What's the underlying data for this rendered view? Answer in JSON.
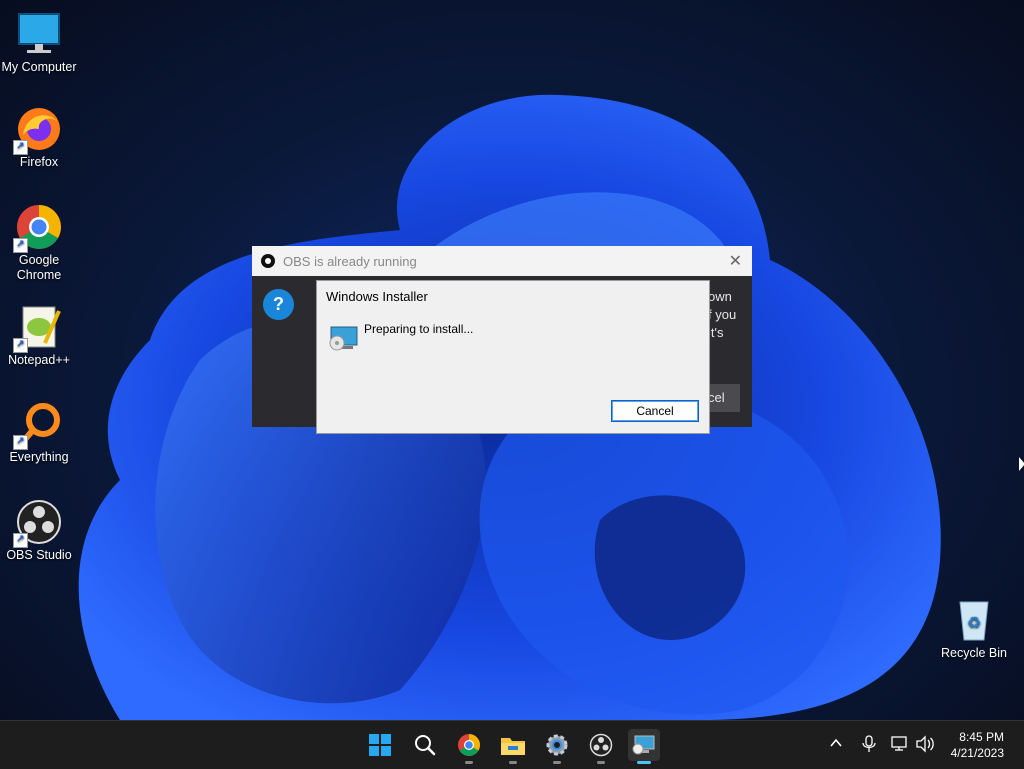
{
  "desktop": {
    "icons": [
      {
        "label": "My Computer",
        "icon": "monitor-icon"
      },
      {
        "label": "Firefox",
        "icon": "firefox-icon"
      },
      {
        "label": "Google Chrome",
        "icon": "chrome-icon"
      },
      {
        "label": "Notepad++",
        "icon": "notepadpp-icon"
      },
      {
        "label": "Everything",
        "icon": "everything-icon"
      },
      {
        "label": "OBS Studio",
        "icon": "obs-icon"
      },
      {
        "label": "Recycle Bin",
        "icon": "recycle-bin-icon"
      }
    ]
  },
  "obs_dialog": {
    "title": "OBS is already running",
    "text_fragments": [
      "own",
      "f you",
      "it's"
    ],
    "button_fragment": "cel"
  },
  "installer_dialog": {
    "title": "Windows Installer",
    "message": "Preparing to install...",
    "cancel_label": "Cancel"
  },
  "taskbar": {
    "apps": [
      "start-icon",
      "search-icon",
      "chrome-icon",
      "file-explorer-icon",
      "settings-icon",
      "obs-icon",
      "windows-installer-icon"
    ],
    "time": "8:45 PM",
    "date": "4/21/2023"
  }
}
